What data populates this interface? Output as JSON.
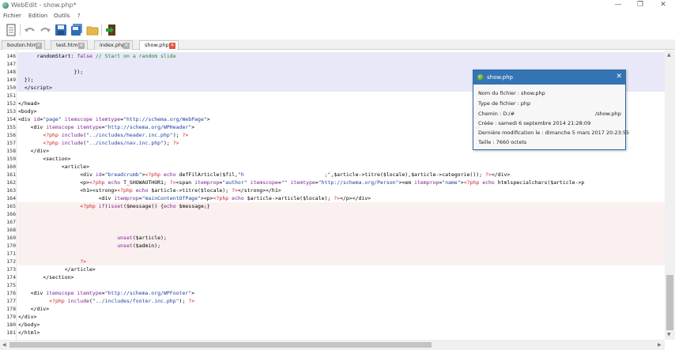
{
  "window": {
    "title": "WebEdit - show.php*",
    "minimize": "—",
    "restore": "❐",
    "close": "✕"
  },
  "menu": [
    "Fichier",
    "Edition",
    "Outils",
    "?"
  ],
  "tabs": [
    {
      "label": "bouton.html",
      "active": false
    },
    {
      "label": "test.html",
      "active": false
    },
    {
      "label": "index.php",
      "active": false
    },
    {
      "label": "show.php",
      "active": true
    }
  ],
  "editor": {
    "lines": [
      {
        "n": "146",
        "band": "purple",
        "html": "      randomStart: <span class=\"k\">false</span> <span class=\"cm\">// Start on a random slide</span>"
      },
      {
        "n": "147",
        "band": "purple",
        "html": ""
      },
      {
        "n": "148",
        "band": "purple",
        "html": "                  });"
      },
      {
        "n": "149",
        "band": "purple",
        "html": "  });"
      },
      {
        "n": "150",
        "band": "purple",
        "html": "  &lt;/script&gt;"
      },
      {
        "n": "151",
        "band": "",
        "html": ""
      },
      {
        "n": "152",
        "band": "",
        "html": "&lt;/head&gt;"
      },
      {
        "n": "153",
        "band": "",
        "html": "&lt;body&gt;"
      },
      {
        "n": "154",
        "band": "",
        "html": "&lt;div <span class=\"k\">id</span>=<span class=\"s\">\"page\"</span> <span class=\"k\">itemscope itemtype</span>=<span class=\"s\">\"http://schema.org/WebPage\"</span>&gt;"
      },
      {
        "n": "155",
        "band": "",
        "html": "    &lt;div <span class=\"k\">itemscope itemtype</span>=<span class=\"s\">\"http://schema.org/WPHeader\"</span>&gt;"
      },
      {
        "n": "156",
        "band": "",
        "html": "        <span class=\"ph\">&lt;?php</span> <span class=\"k\">include</span>(<span class=\"s\">\"../includes/header.inc.php\"</span>); <span class=\"ph\">?&gt;</span>"
      },
      {
        "n": "157",
        "band": "",
        "html": "        <span class=\"ph\">&lt;?php</span> <span class=\"k\">include</span>(<span class=\"s\">\"../includes/nav.inc.php\"</span>); <span class=\"ph\">?&gt;</span>"
      },
      {
        "n": "158",
        "band": "",
        "html": "    &lt;/div&gt;"
      },
      {
        "n": "159",
        "band": "",
        "html": "        &lt;section&gt;"
      },
      {
        "n": "160",
        "band": "",
        "html": "              &lt;article&gt;"
      },
      {
        "n": "161",
        "band": "",
        "html": "                    &lt;div <span class=\"k\">id</span>=<span class=\"s\">\"breadcrumb\"</span>&gt;<span class=\"ph\">&lt;?php</span> <span class=\"k\">echo</span> defFilArticle($fil,<span class=\"s\">\"h                          ;\"</span>,$article-&gt;titre($locale),$article-&gt;categorie()); <span class=\"ph\">?&gt;</span>&lt;/div&gt;"
      },
      {
        "n": "162",
        "band": "",
        "html": "                    &lt;p&gt;<span class=\"ph\">&lt;?php</span> <span class=\"k\">echo</span> T_SHOWAUTHOR1; <span class=\"ph\">?&gt;</span>&lt;span <span class=\"k\">itemprop</span>=<span class=\"s\">\"author\"</span> <span class=\"k\">itemscope</span>=<span class=\"s\">\"\"</span> <span class=\"k\">itemtype</span>=<span class=\"s\">\"http://schema.org/Person\"</span>&gt;&lt;em <span class=\"k\">itemprop</span>=<span class=\"s\">\"name\"</span>&gt;<span class=\"ph\">&lt;?php</span> <span class=\"k\">echo</span> htmlspecialchars($article-&gt;p"
      },
      {
        "n": "163",
        "band": "",
        "html": "                    &lt;h1&gt;&lt;strong&gt;<span class=\"ph\">&lt;?php</span> <span class=\"k\">echo</span> $article-&gt;titre($locale); <span class=\"ph\">?&gt;</span>&lt;/strong&gt;&lt;/h1&gt;"
      },
      {
        "n": "164",
        "band": "",
        "html": "                          &lt;div <span class=\"k\">itemprop</span>=<span class=\"s\">\"mainContentOfPage\"</span>&gt;&lt;p&gt;<span class=\"ph\">&lt;?php</span> <span class=\"k\">echo</span> $article-&gt;article($locale); <span class=\"ph\">?&gt;</span>&lt;/p&gt;&lt;/div&gt;"
      },
      {
        "n": "165",
        "band": "pink",
        "html": "                    <span class=\"ph\">&lt;?php</span> <span class=\"k\">if</span>(<span class=\"k\">isset</span>($message)) {<span class=\"k\">echo</span> $message;}"
      },
      {
        "n": "166",
        "band": "pink",
        "html": ""
      },
      {
        "n": "167",
        "band": "pink",
        "html": ""
      },
      {
        "n": "168",
        "band": "pink",
        "html": ""
      },
      {
        "n": "169",
        "band": "pink",
        "html": "                                <span class=\"k\">unset</span>($article);"
      },
      {
        "n": "170",
        "band": "pink",
        "html": "                                <span class=\"k\">unset</span>($admin);"
      },
      {
        "n": "171",
        "band": "pink",
        "html": ""
      },
      {
        "n": "172",
        "band": "pink",
        "html": "                    <span class=\"ph\">?&gt;</span>"
      },
      {
        "n": "173",
        "band": "",
        "html": "               &lt;/article&gt;"
      },
      {
        "n": "174",
        "band": "",
        "html": "        &lt;/section&gt;"
      },
      {
        "n": "175",
        "band": "",
        "html": ""
      },
      {
        "n": "176",
        "band": "",
        "html": "    &lt;div <span class=\"k\">itemscope itemtype</span>=<span class=\"s\">\"http://schema.org/WPFooter\"</span>&gt;"
      },
      {
        "n": "177",
        "band": "",
        "html": "          <span class=\"ph\">&lt;?php</span> <span class=\"k\">include</span>(<span class=\"s\">\"../includes/footer.inc.php\"</span>); <span class=\"ph\">?&gt;</span>"
      },
      {
        "n": "178",
        "band": "",
        "html": "    &lt;/div&gt;"
      },
      {
        "n": "179",
        "band": "",
        "html": "&lt;/div&gt;"
      },
      {
        "n": "180",
        "band": "",
        "html": "&lt;/body&gt;"
      },
      {
        "n": "181",
        "band": "",
        "html": "&lt;/html&gt;"
      }
    ]
  },
  "popup": {
    "title": "show.php",
    "close": "✕",
    "nom": "Nom du fichier : show.php",
    "type": "Type de fichier : php",
    "chemin_label": "Chemin : D:/#",
    "chemin_value": "/show.php",
    "cree": "Créée : samedi 6 septembre 2014 21:28:09",
    "modif": "Dernière modification le : dimanche 5 mars 2017 20:23:55",
    "taille": "Taille : 7660 octets"
  },
  "colors": {
    "accent": "#3574b4",
    "band_purple": "#e8e8f8",
    "band_pink": "#fbf0f0"
  }
}
